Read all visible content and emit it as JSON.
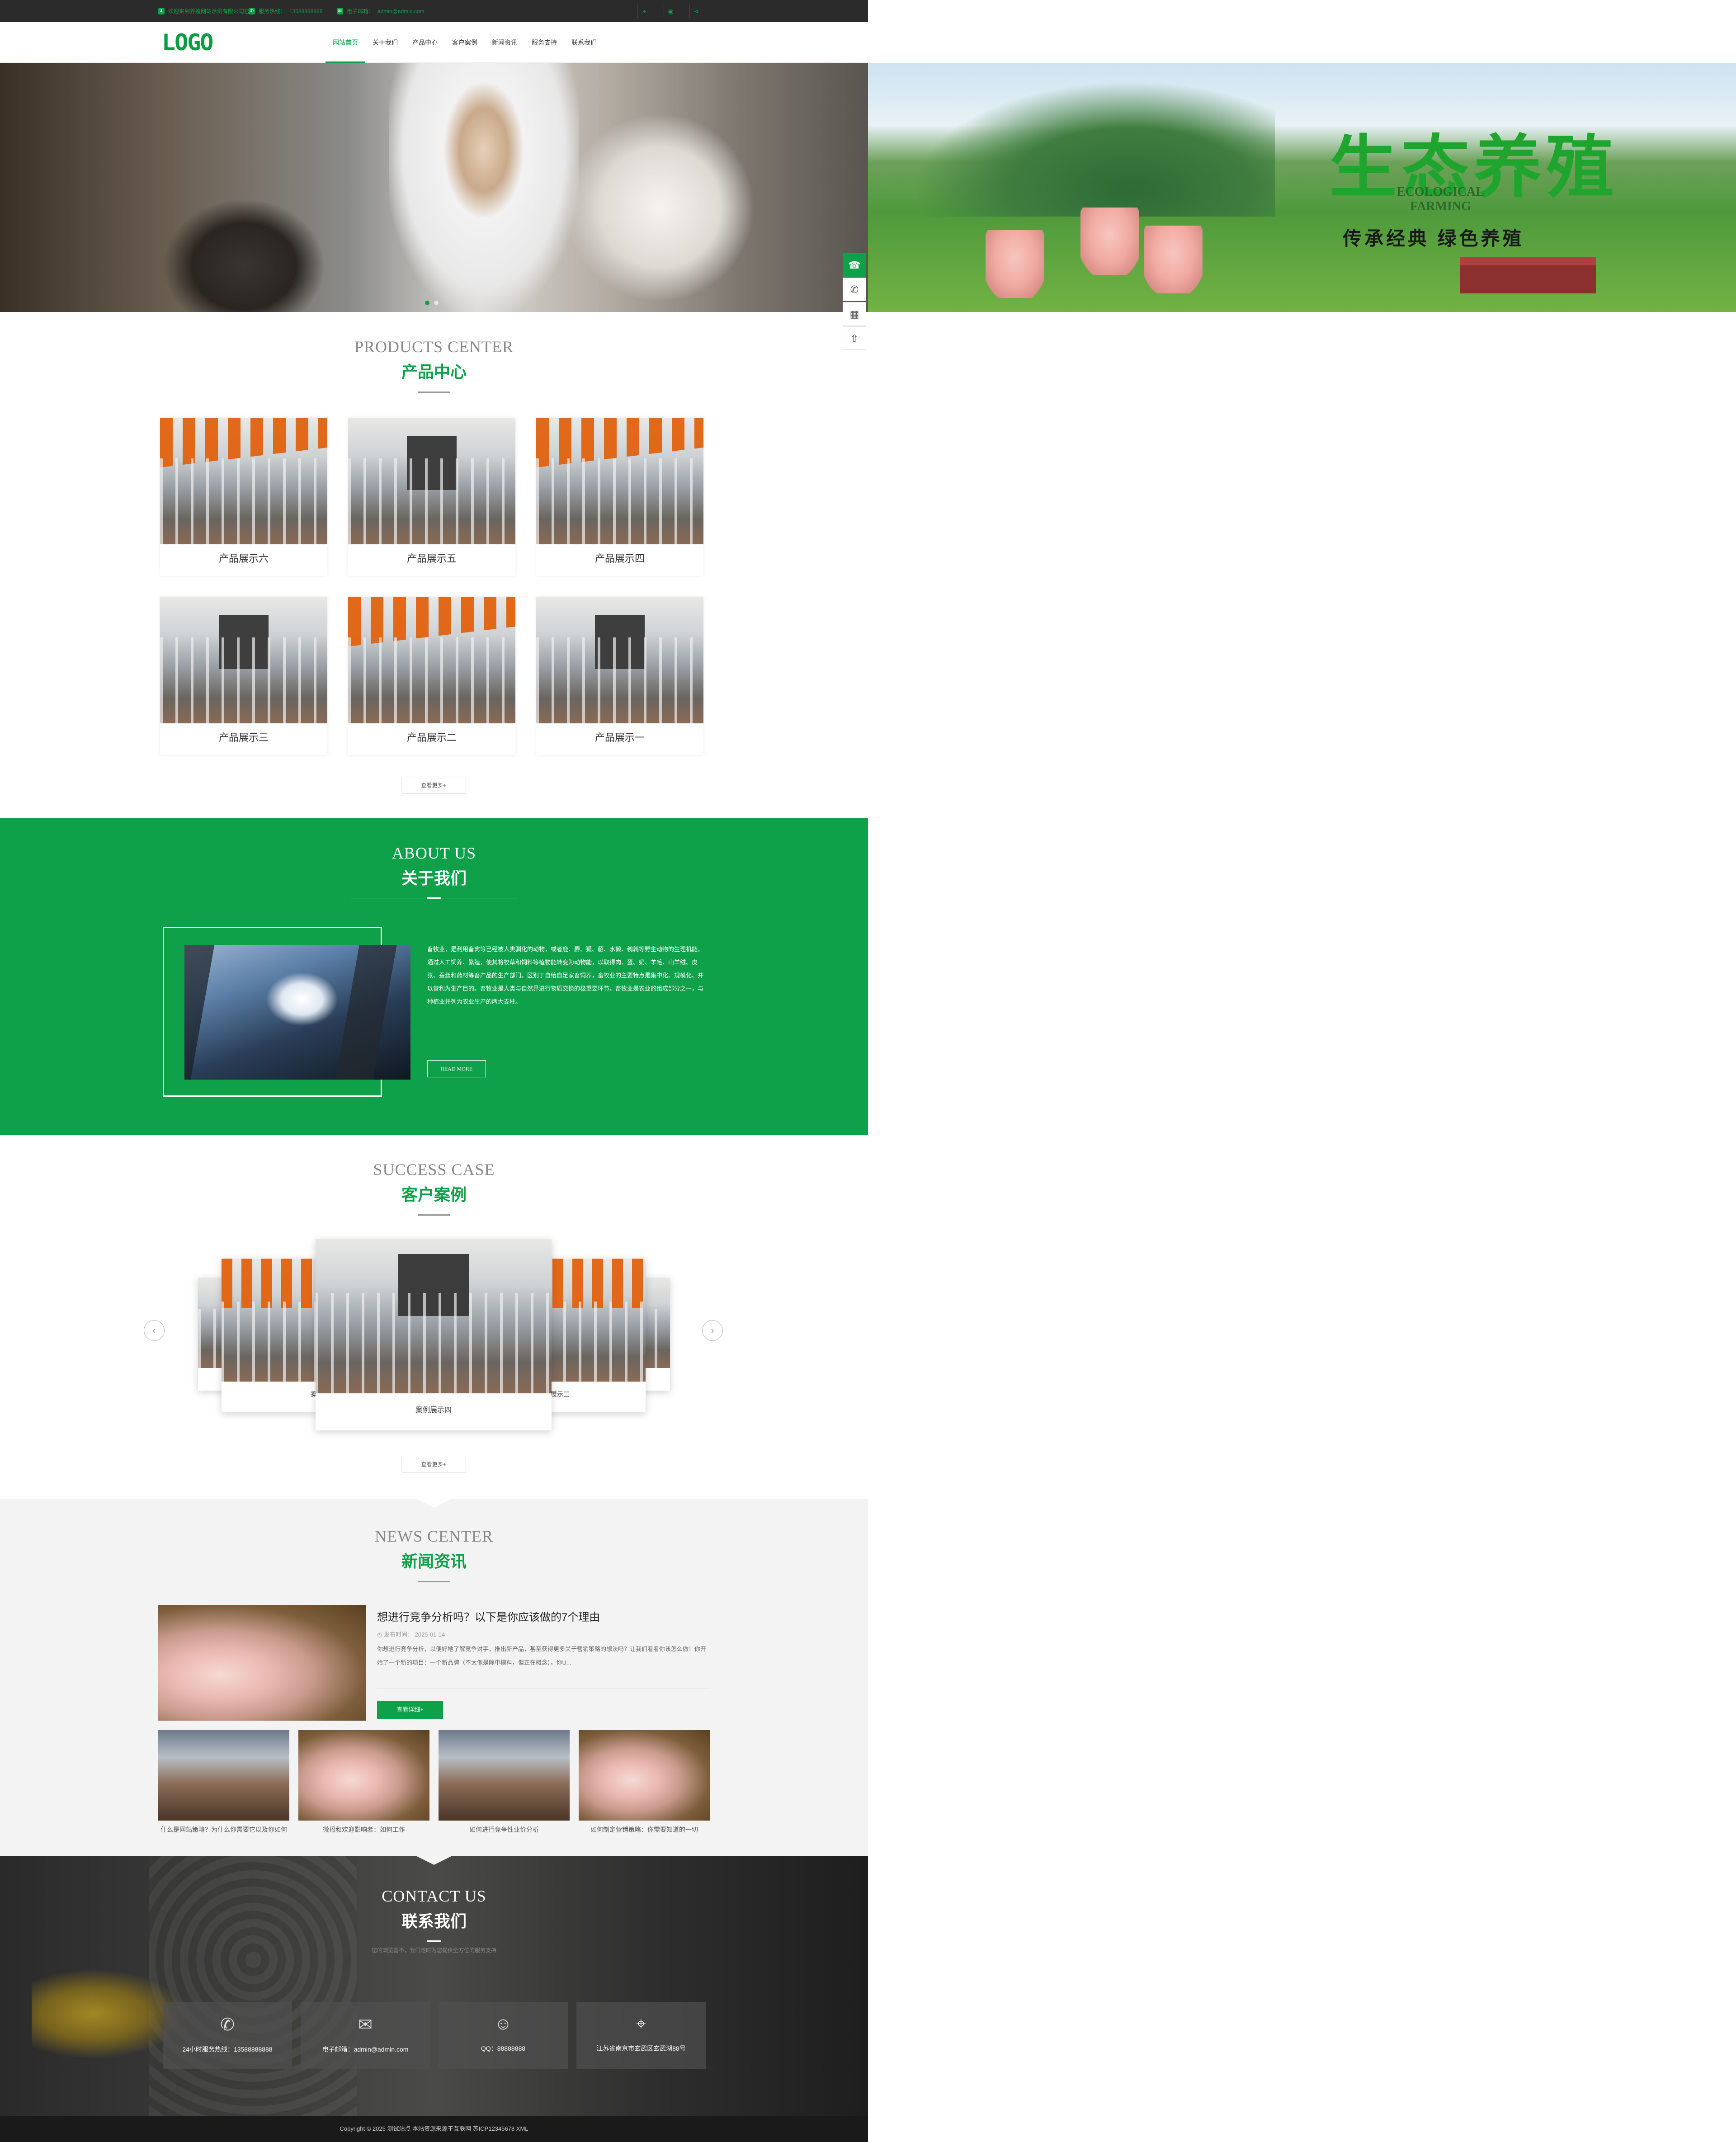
{
  "topbar": {
    "company": "欢迎来到养殖网站示例有限公司官网",
    "hotline_label": "服务热线：",
    "hotline": "13588888888",
    "email_label": "电子邮箱：",
    "email": "admin@admin.com"
  },
  "header": {
    "logo": "LOGO",
    "nav": [
      "网站首页",
      "关于我们",
      "产品中心",
      "客户案例",
      "新闻资讯",
      "服务支持",
      "联系我们"
    ]
  },
  "banner2": {
    "title": "生态养殖",
    "en_line1": "ECOLOGICAL",
    "en_line2": "FARMING",
    "subtitle": "传承经典 绿色养殖"
  },
  "products": {
    "en": "PRODUCTS CENTER",
    "cn": "产品中心",
    "items": [
      "产品展示六",
      "产品展示五",
      "产品展示四",
      "产品展示三",
      "产品展示二",
      "产品展示一"
    ],
    "more": "查看更多+"
  },
  "about": {
    "en": "ABOUT US",
    "cn": "关于我们",
    "text": "畜牧业，是利用畜禽等已经被人类驯化的动物，或者鹿、麝、狐、貂、水獭、鹌鹑等野生动物的生理机能，通过人工饲养、繁殖，使其将牧草和饲料等植物能转变为动物能，以取得肉、蛋、奶、羊毛、山羊绒、皮张、蚕丝和药材等畜产品的生产部门。区别于自给自足家畜饲养，畜牧业的主要特点是集中化、规模化、并以营利为生产目的。畜牧业是人类与自然界进行物质交换的极重要环节。畜牧业是农业的组成部分之一，与种植业并列为农业生产的两大支柱。",
    "readmore": "READ MORE"
  },
  "cases": {
    "en": "SUCCESS CASE",
    "cn": "客户案例",
    "center": "案例展示四",
    "left": "案例展",
    "right": "展示三",
    "more": "查看更多+"
  },
  "news": {
    "en": "NEWS CENTER",
    "cn": "新闻资讯",
    "main_title": "想进行竞争分析吗？以下是你应该做的7个理由",
    "date_label": "发布时间：",
    "date": "2025-01-14",
    "desc": "你想进行竞争分析，以便好地了解竞争对手，推出新产品，甚至获得更多关于营销策略的想法吗？让我们看看你该怎么做！你开始了一个新的项目：一个新品牌（不太像是除中模料，但正在概念）。你U...",
    "detail": "查看详细+",
    "thumbs": [
      "什么是网站策略？为什么你需要它以及你如何",
      "微招和欢迎影响者：如何工作",
      "如何进行竞争性业价分析",
      "如何制定营销策略：你需要知道的一切"
    ]
  },
  "contact": {
    "en": "CONTACT US",
    "cn": "联系我们",
    "subtitle": "您的浏览器不，我们随时为您提供全方位的服务支持",
    "boxes": [
      {
        "icon": "phone-24-icon",
        "text": "24小时服务热线：13588888888"
      },
      {
        "icon": "mail-icon",
        "text": "电子邮箱：admin@admin.com"
      },
      {
        "icon": "qq-icon",
        "text": "QQ：88888888"
      },
      {
        "icon": "location-icon",
        "text": "江苏省南京市玄武区玄武湖88号"
      }
    ]
  },
  "footer": {
    "text": "Copyright © 2025 测试站点 本站资源来源于互联网 苏ICP12345678 XML"
  },
  "colors": {
    "brand_green": "#0fa14a",
    "topbar_bg": "#2b2b2b",
    "news_bg": "#f3f3f3"
  }
}
